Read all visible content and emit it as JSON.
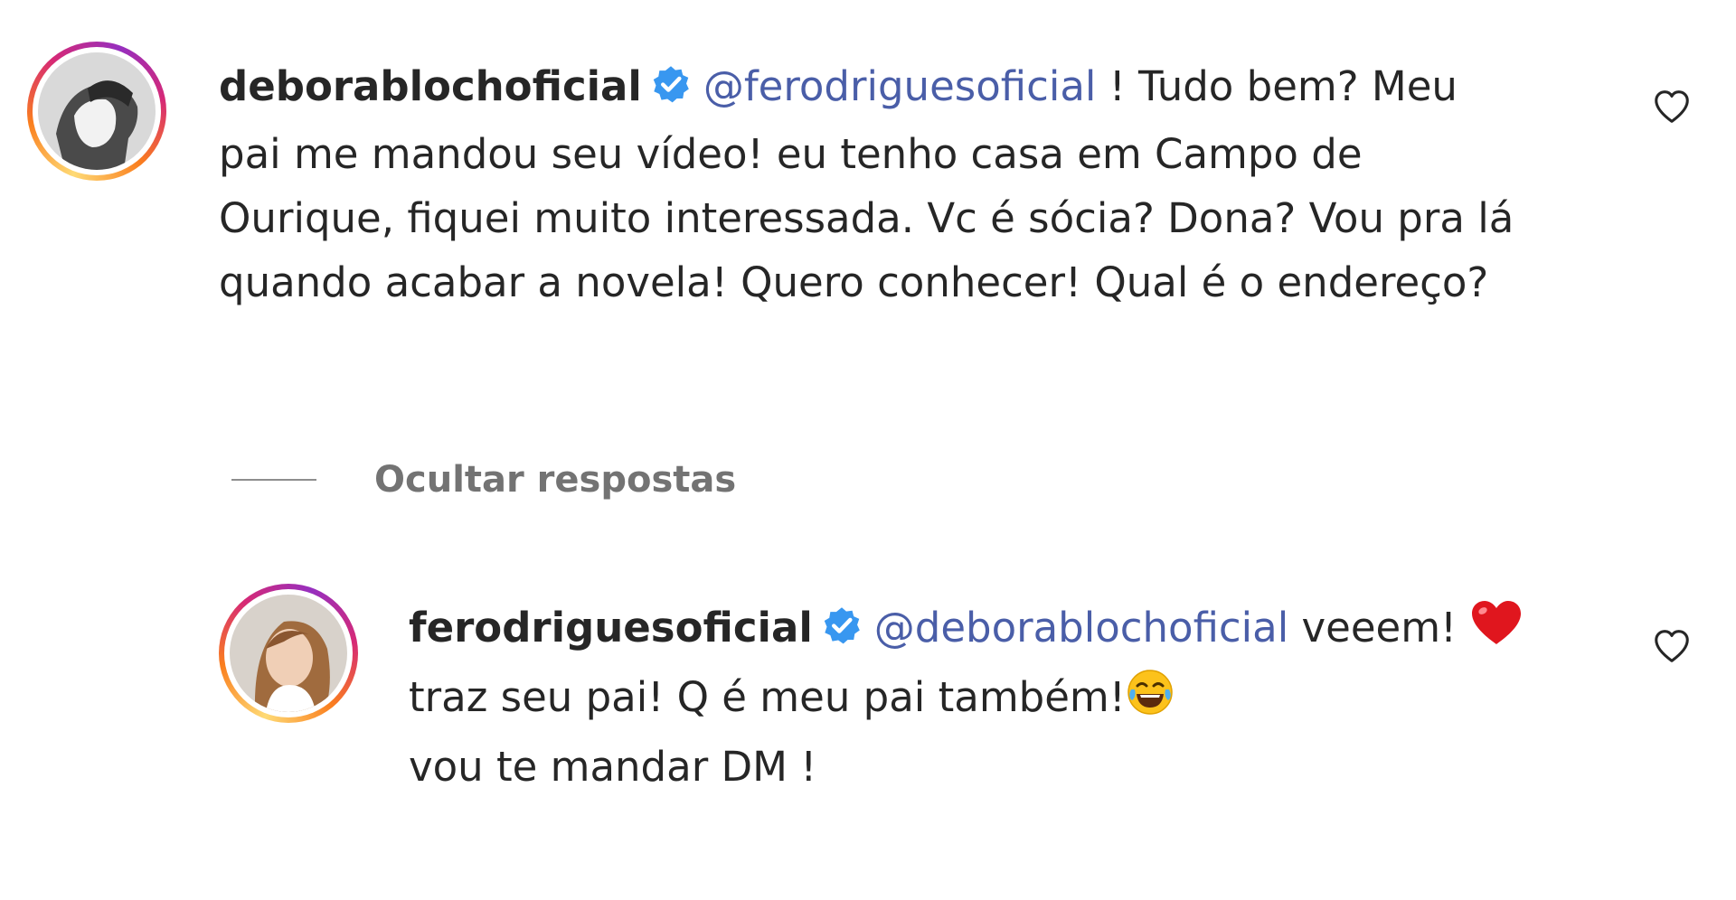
{
  "comments": [
    {
      "username": "deborablochoficial",
      "verified": true,
      "mention": "@ferodriguesoficial",
      "lines": [
        " ! Tudo bem? Meu",
        "pai me mandou seu vídeo! eu tenho casa em Campo de",
        "Ourique, fiquei muito interessada. Vc é sócia? Dona? Vou pra lá",
        "quando acabar a novela! Quero conhecer! Qual é o endereço?"
      ]
    }
  ],
  "replies_toggle": {
    "label": "Ocultar respostas"
  },
  "replies": [
    {
      "username": "ferodriguesoficial",
      "verified": true,
      "mention": "@deborablochoficial",
      "lines": [
        " veeem! ",
        "traz seu pai! Q é meu pai também!",
        "vou te mandar DM !"
      ],
      "emojis": [
        "red-heart",
        "tears-of-joy"
      ]
    }
  ],
  "colors": {
    "mention": "#4a5ea8",
    "verified_badge": "#3897f0",
    "heart_red": "#e0161e",
    "muted": "#737373"
  }
}
